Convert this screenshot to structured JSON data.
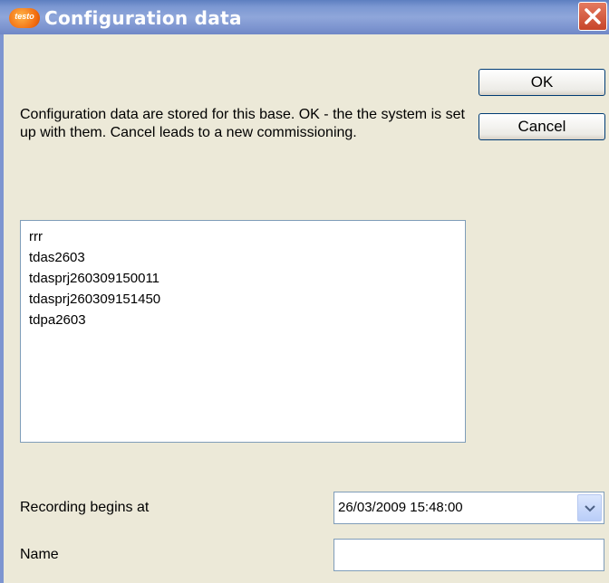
{
  "window": {
    "title": "Configuration data",
    "logo_text": "testo"
  },
  "buttons": {
    "ok_label": "OK",
    "cancel_label": "Cancel"
  },
  "message": "Configuration data are stored for this base. OK - the the system is set up with them. Cancel leads to a new commissioning.",
  "list": {
    "items": [
      "rrr",
      "tdas2603",
      "tdasprj260309150011",
      "tdasprj260309151450",
      "tdpa2603"
    ]
  },
  "recording": {
    "label": "Recording begins at",
    "value": "26/03/2009 15:48:00"
  },
  "name": {
    "label": "Name",
    "value": ""
  }
}
